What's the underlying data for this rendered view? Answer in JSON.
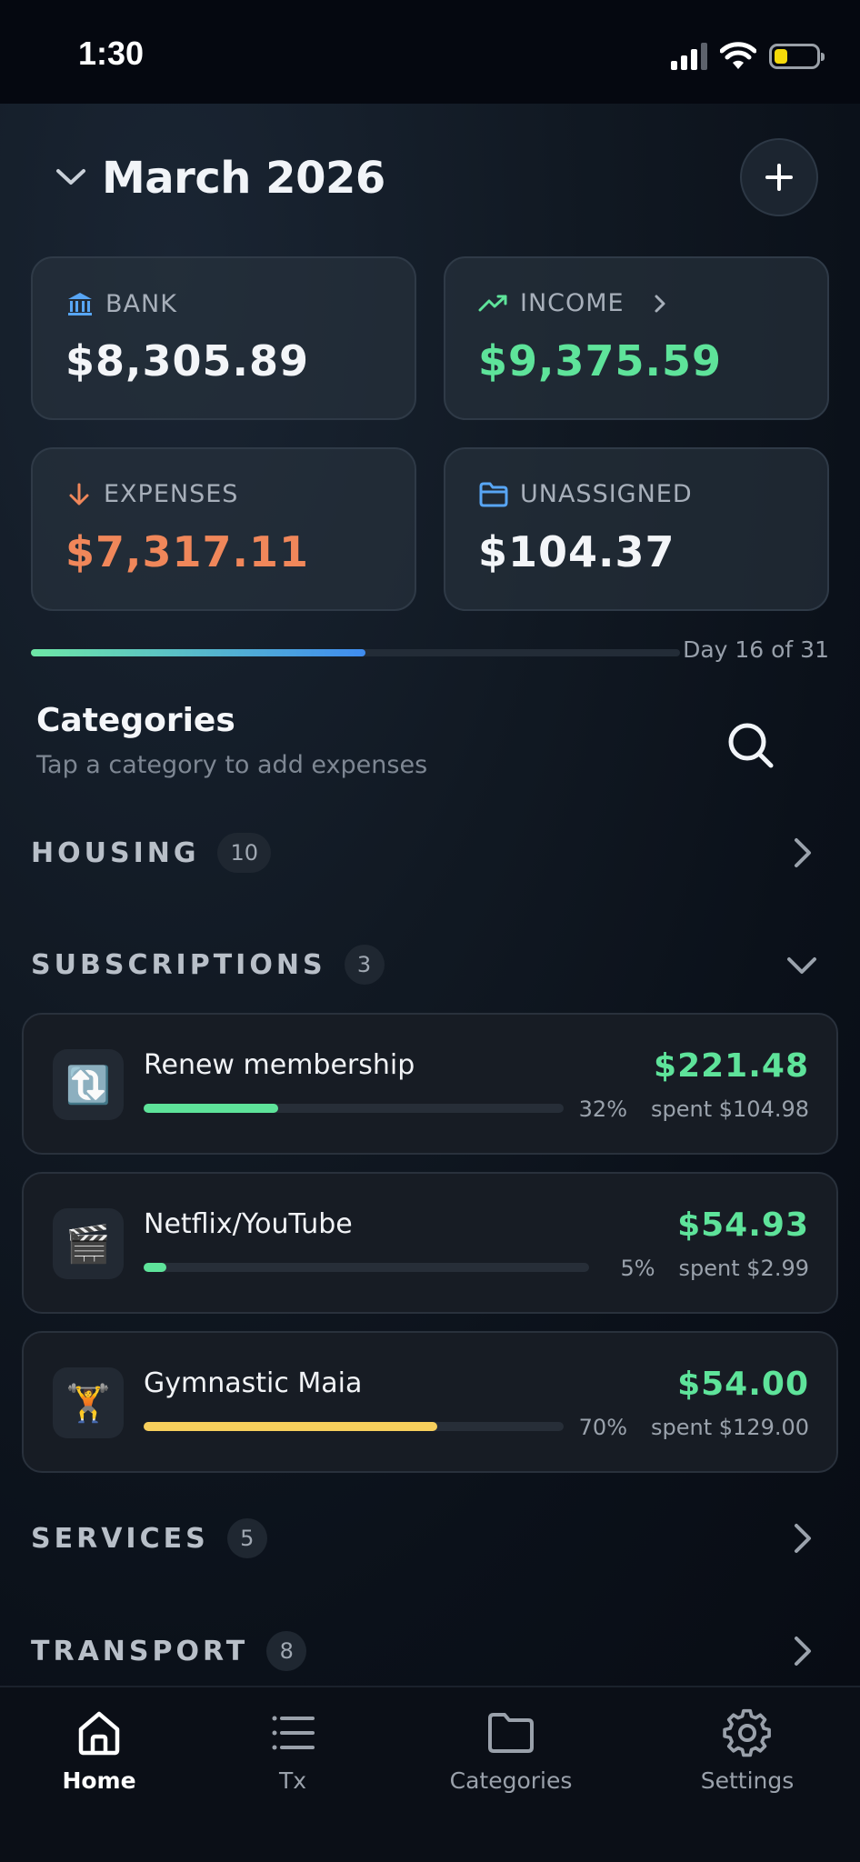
{
  "status": {
    "time": "1:30"
  },
  "header": {
    "month": "March 2026"
  },
  "summary": {
    "bank": {
      "label": "BANK",
      "value": "$8,305.89"
    },
    "income": {
      "label": "INCOME",
      "value": "$9,375.59"
    },
    "expenses": {
      "label": "EXPENSES",
      "value": "$7,317.11"
    },
    "unassigned": {
      "label": "UNASSIGNED",
      "value": "$104.37"
    }
  },
  "month_progress": {
    "fraction": 0.516,
    "label": "Day 16 of 31"
  },
  "categories": {
    "title": "Categories",
    "subtitle": "Tap a category to add expenses",
    "groups": [
      {
        "name": "HOUSING",
        "count": "10",
        "expanded": false
      },
      {
        "name": "SUBSCRIPTIONS",
        "count": "3",
        "expanded": true
      },
      {
        "name": "SERVICES",
        "count": "5",
        "expanded": false
      },
      {
        "name": "TRANSPORT",
        "count": "8",
        "expanded": false
      }
    ],
    "subscriptions": [
      {
        "icon": "🔃",
        "name": "Renew membership",
        "amount": "$221.48",
        "percent": "32%",
        "spent": "spent $104.98",
        "fill_fraction": 0.32,
        "color": "#5ee39a"
      },
      {
        "icon": "🎬",
        "name": "Netflix/YouTube",
        "amount": "$54.93",
        "percent": "5%",
        "spent": "spent $2.99",
        "fill_fraction": 0.05,
        "color": "#5ee39a"
      },
      {
        "icon": "🏋️",
        "name": "Gymnastic Maia",
        "amount": "$54.00",
        "percent": "70%",
        "spent": "spent $129.00",
        "fill_fraction": 0.7,
        "color": "#f7cf5c"
      }
    ]
  },
  "nav": {
    "home": "Home",
    "tx": "Tx",
    "categories": "Categories",
    "settings": "Settings"
  },
  "colors": {
    "income": "#5ee39a",
    "expenses": "#f0875a",
    "accent_blue": "#3f8cf0"
  }
}
